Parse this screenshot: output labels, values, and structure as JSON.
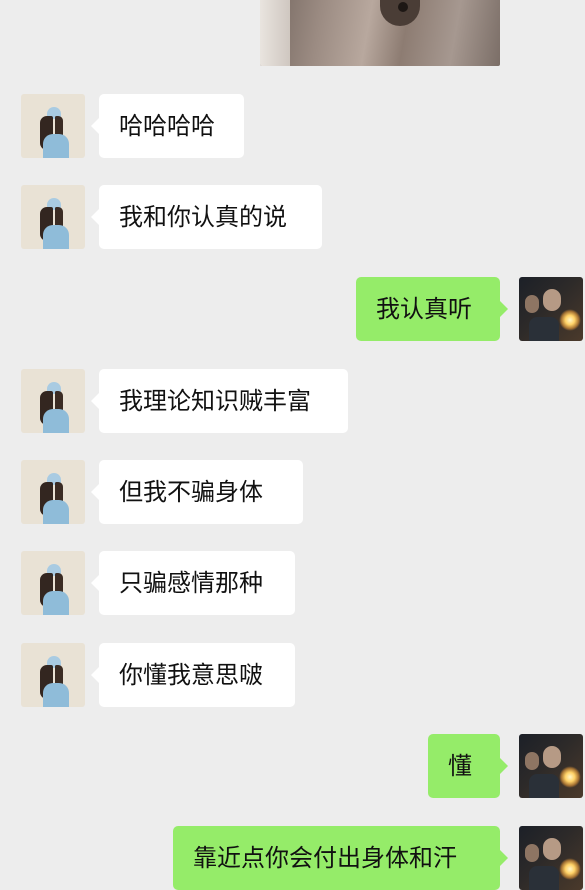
{
  "theme": {
    "background": "#ededed",
    "incoming_bubble": "#ffffff",
    "outgoing_bubble": "#95ec69",
    "text": "#111111"
  },
  "messages": [
    {
      "side": "incoming",
      "text": "哈哈哈哈"
    },
    {
      "side": "incoming",
      "text": "我和你认真的说"
    },
    {
      "side": "outgoing",
      "text": "我认真听"
    },
    {
      "side": "incoming",
      "text": "我理论知识贼丰富"
    },
    {
      "side": "incoming",
      "text": "但我不骗身体"
    },
    {
      "side": "incoming",
      "text": "只骗感情那种"
    },
    {
      "side": "incoming",
      "text": "你懂我意思啵"
    },
    {
      "side": "outgoing",
      "text": "懂"
    },
    {
      "side": "outgoing",
      "text": "靠近点你会付出身体和汗"
    }
  ]
}
